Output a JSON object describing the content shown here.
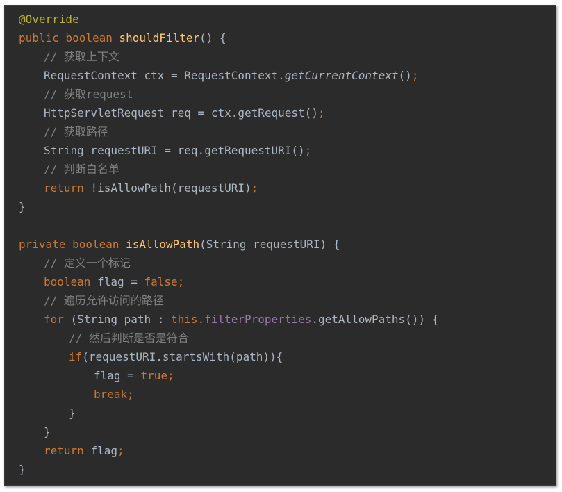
{
  "editor": {
    "lines": [
      {
        "indent": 0,
        "tokens": [
          {
            "c": "annotation",
            "t": "@Override"
          }
        ]
      },
      {
        "indent": 0,
        "tokens": [
          {
            "c": "kw",
            "t": "public boolean "
          },
          {
            "c": "fn",
            "t": "shouldFilter"
          },
          {
            "c": "",
            "t": "() {"
          }
        ]
      },
      {
        "indent": 1,
        "tokens": [
          {
            "c": "cm",
            "t": "// 获取上下文"
          }
        ]
      },
      {
        "indent": 1,
        "tokens": [
          {
            "c": "",
            "t": "RequestContext ctx = RequestContext."
          },
          {
            "c": "it",
            "t": "getCurrentContext"
          },
          {
            "c": "",
            "t": "()"
          },
          {
            "c": "punc",
            "t": ";"
          }
        ]
      },
      {
        "indent": 1,
        "tokens": [
          {
            "c": "cm",
            "t": "// 获取request"
          }
        ]
      },
      {
        "indent": 1,
        "tokens": [
          {
            "c": "",
            "t": "HttpServletRequest req = ctx.getRequest()"
          },
          {
            "c": "punc",
            "t": ";"
          }
        ]
      },
      {
        "indent": 1,
        "tokens": [
          {
            "c": "cm",
            "t": "// 获取路径"
          }
        ]
      },
      {
        "indent": 1,
        "tokens": [
          {
            "c": "",
            "t": "String requestURI = req.getRequestURI()"
          },
          {
            "c": "punc",
            "t": ";"
          }
        ]
      },
      {
        "indent": 1,
        "tokens": [
          {
            "c": "cm",
            "t": "// 判断白名单"
          }
        ]
      },
      {
        "indent": 1,
        "tokens": [
          {
            "c": "kw",
            "t": "return "
          },
          {
            "c": "",
            "t": "!isAllowPath(requestURI)"
          },
          {
            "c": "punc",
            "t": ";"
          }
        ]
      },
      {
        "indent": 0,
        "tokens": [
          {
            "c": "",
            "t": "}"
          }
        ]
      },
      {
        "indent": 0,
        "blank": true,
        "tokens": []
      },
      {
        "indent": 0,
        "tokens": [
          {
            "c": "kw",
            "t": "private boolean "
          },
          {
            "c": "fn",
            "t": "isAllowPath"
          },
          {
            "c": "",
            "t": "(String requestURI) {"
          }
        ]
      },
      {
        "indent": 1,
        "tokens": [
          {
            "c": "cm",
            "t": "// 定义一个标记"
          }
        ]
      },
      {
        "indent": 1,
        "tokens": [
          {
            "c": "kw",
            "t": "boolean "
          },
          {
            "c": "",
            "t": "flag = "
          },
          {
            "c": "kw",
            "t": "false;"
          }
        ]
      },
      {
        "indent": 1,
        "tokens": [
          {
            "c": "cm",
            "t": "// 遍历允许访问的路径"
          }
        ]
      },
      {
        "indent": 1,
        "tokens": [
          {
            "c": "kw",
            "t": "for "
          },
          {
            "c": "",
            "t": "(String path : "
          },
          {
            "c": "kw",
            "t": "this."
          },
          {
            "c": "field",
            "t": "filterProperties"
          },
          {
            "c": "",
            "t": ".getAllowPaths()) {"
          }
        ]
      },
      {
        "indent": 2,
        "tokens": [
          {
            "c": "cm",
            "t": "// 然后判断是否是符合"
          }
        ]
      },
      {
        "indent": 2,
        "tokens": [
          {
            "c": "kw",
            "t": "if"
          },
          {
            "c": "",
            "t": "(requestURI.startsWith(path)){"
          }
        ]
      },
      {
        "indent": 3,
        "tokens": [
          {
            "c": "",
            "t": "flag = "
          },
          {
            "c": "kw",
            "t": "true;"
          }
        ]
      },
      {
        "indent": 3,
        "tokens": [
          {
            "c": "kw",
            "t": "break;"
          }
        ]
      },
      {
        "indent": 2,
        "tokens": [
          {
            "c": "",
            "t": "}"
          }
        ]
      },
      {
        "indent": 1,
        "tokens": [
          {
            "c": "",
            "t": "}"
          }
        ]
      },
      {
        "indent": 1,
        "tokens": [
          {
            "c": "kw",
            "t": "return "
          },
          {
            "c": "",
            "t": "flag"
          },
          {
            "c": "punc",
            "t": ";"
          }
        ]
      },
      {
        "indent": 0,
        "tokens": [
          {
            "c": "",
            "t": "}"
          }
        ]
      }
    ]
  }
}
